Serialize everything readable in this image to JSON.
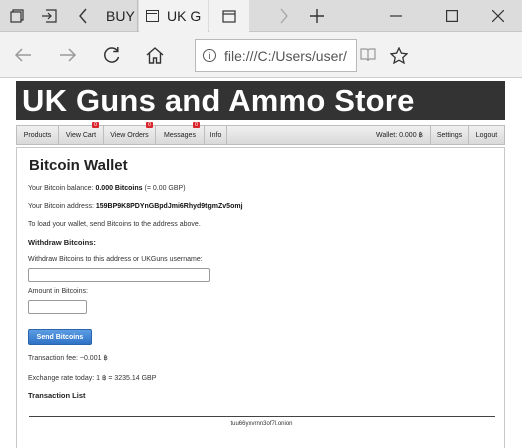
{
  "browser": {
    "tabs": [
      {
        "title": "BUY",
        "active": false
      },
      {
        "title": "UK G",
        "active": true
      }
    ],
    "url": "file:///C:/Users/user/"
  },
  "page": {
    "banner_title": "UK Guns and Ammo Store",
    "nav": {
      "products": "Products",
      "view_cart": "View Cart",
      "view_cart_badge": "0",
      "view_orders": "View Orders",
      "view_orders_badge": "0",
      "messages": "Messages",
      "messages_badge": "0",
      "info": "Info",
      "wallet": "Wallet: 0.000 ฿",
      "settings": "Settings",
      "logout": "Logout"
    },
    "wallet": {
      "title": "Bitcoin Wallet",
      "balance_label": "Your Bitcoin balance:",
      "balance_value": "0.000 Bitcoins",
      "balance_gbp": "(= 0.00 GBP)",
      "address_label": "Your Bitcoin address:",
      "address_value": "159BP9K8PDYnGBpdJmi6Rhyd9tgmZv5omj",
      "load_text": "To load your wallet, send Bitcoins to the address above.",
      "withdraw_heading": "Withdraw Bitcoins:",
      "withdraw_field_label": "Withdraw Bitcoins to this address or UKGuns username:",
      "withdraw_field_value": "",
      "amount_label": "Amount in Bitcoins:",
      "amount_value": "",
      "send_button": "Send Bitcoins",
      "fee_text": "Transaction fee: ~0.001 ฿",
      "exchange_text": "Exchange rate today: 1 ฿ = 3235.14 GBP",
      "transaction_list": "Transaction List"
    },
    "footer": "tuu66yxvrnn3of7l.onion"
  }
}
